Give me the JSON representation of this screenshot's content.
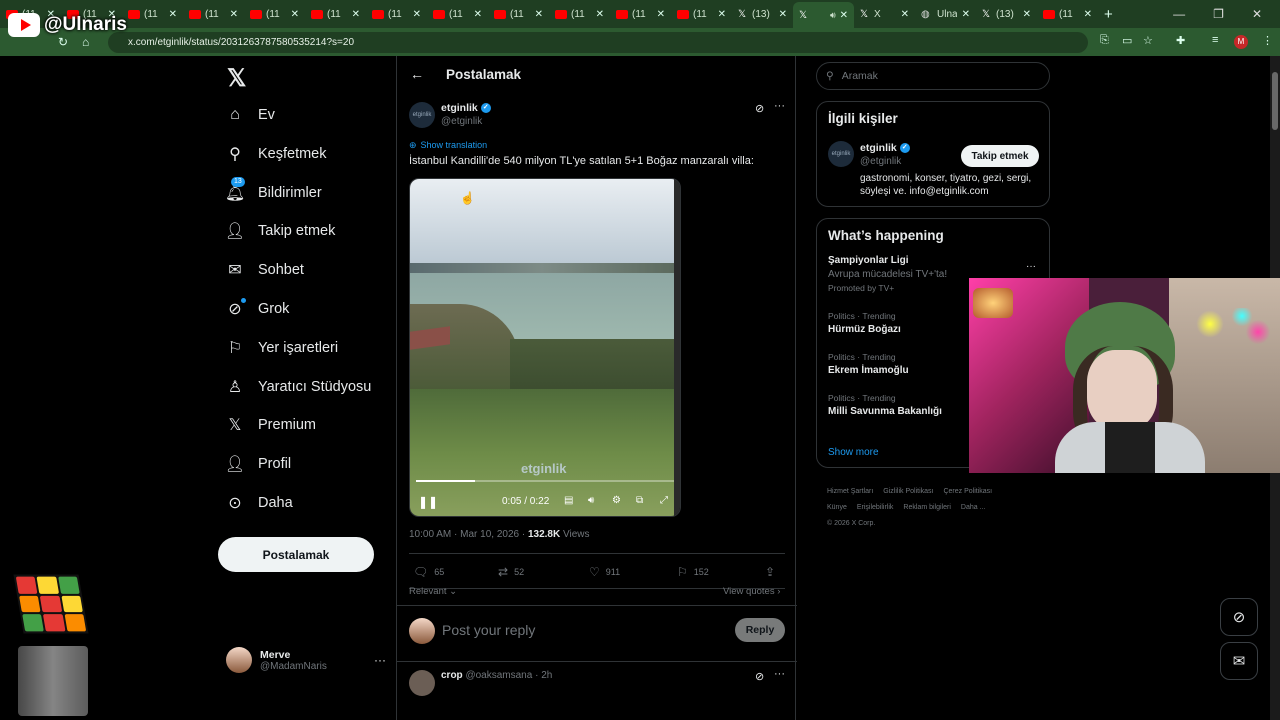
{
  "overlay": {
    "channel_name": "@Ulnaris"
  },
  "browser": {
    "tabs": [
      {
        "icon": "youtube",
        "title": "(11"
      },
      {
        "icon": "youtube",
        "title": "(11"
      },
      {
        "icon": "youtube",
        "title": "(11"
      },
      {
        "icon": "youtube",
        "title": "(11"
      },
      {
        "icon": "youtube",
        "title": "(11"
      },
      {
        "icon": "youtube",
        "title": "(11"
      },
      {
        "icon": "youtube",
        "title": "(11"
      },
      {
        "icon": "youtube",
        "title": "(11"
      },
      {
        "icon": "youtube",
        "title": "(11"
      },
      {
        "icon": "youtube",
        "title": "(11"
      },
      {
        "icon": "youtube",
        "title": "(11"
      },
      {
        "icon": "youtube",
        "title": "(11"
      },
      {
        "icon": "x",
        "title": "(13)"
      },
      {
        "icon": "x",
        "title": "",
        "active": true
      },
      {
        "icon": "x",
        "title": "X"
      },
      {
        "icon": "globe",
        "title": "Ulna"
      },
      {
        "icon": "x",
        "title": "(13)"
      },
      {
        "icon": "youtube",
        "title": "(11"
      }
    ],
    "url": "x.com/etginlik/status/2031263787580535214?s=20",
    "profile_initial": "M"
  },
  "nav": {
    "items": [
      {
        "label": "Ev",
        "icon": "home-icon"
      },
      {
        "label": "Keşfetmek",
        "icon": "search-icon"
      },
      {
        "label": "Bildirimler",
        "icon": "bell-icon",
        "badge": "13"
      },
      {
        "label": "Takip etmek",
        "icon": "follow-icon"
      },
      {
        "label": "Sohbet",
        "icon": "mail-icon"
      },
      {
        "label": "Grok",
        "icon": "grok-icon"
      },
      {
        "label": "Yer işaretleri",
        "icon": "bookmark-icon"
      },
      {
        "label": "Yaratıcı Stüdyosu",
        "icon": "studio-icon"
      },
      {
        "label": "Premium",
        "icon": "x-icon"
      },
      {
        "label": "Profil",
        "icon": "profile-icon"
      },
      {
        "label": "Daha",
        "icon": "more-icon"
      }
    ],
    "post_button": "Postalamak",
    "account": {
      "name": "Merve",
      "handle": "@MadamNaris"
    }
  },
  "timeline": {
    "title": "Postalamak",
    "author": {
      "name": "etginlik",
      "handle": "@etginlik",
      "avatar_text": "etginlik"
    },
    "show_translation": "Show translation",
    "text": "İstanbul Kandilli'de 540 milyon TL'ye satılan 5+1 Boğaz manzaralı villa:",
    "video": {
      "watermark": "etginlik",
      "time": "0:05 / 0:22",
      "progress": 0.23
    },
    "meta": {
      "time": "10:00 AM · Mar 10, 2026 · ",
      "views": "132.8K",
      "views_label": " Views"
    },
    "actions": {
      "replies": "65",
      "reposts": "52",
      "likes": "911",
      "bookmarks": "152"
    },
    "relevant": "Relevant",
    "view_quotes": "View quotes",
    "reply_placeholder": "Post your reply",
    "reply_button": "Reply",
    "first_reply": {
      "name": "crop",
      "handle": "@oaksamsana · 2h"
    }
  },
  "sidebar": {
    "search_placeholder": "Aramak",
    "related": {
      "title": "İlgili kişiler",
      "name": "etginlik",
      "handle": "@etginlik",
      "follow": "Takip etmek",
      "bio": "gastronomi, konser, tiyatro, gezi, sergi, söyleşi ve. info@etginlik.com"
    },
    "happening": {
      "title": "What’s happening",
      "trends": [
        {
          "context": "",
          "name": "Şampiyonlar Ligi",
          "sub": "Avrupa mücadelesi TV+'ta!",
          "promo": "Promoted by TV+"
        },
        {
          "context": "Politics · Trending",
          "name": "Hürmüz Boğazı",
          "sub": "",
          "promo": ""
        },
        {
          "context": "Politics · Trending",
          "name": "Ekrem İmamoğlu",
          "sub": "",
          "promo": ""
        },
        {
          "context": "Politics · Trending",
          "name": "Milli Savunma Bakanlığı",
          "sub": "",
          "promo": ""
        }
      ],
      "show_more": "Show more"
    },
    "footer": [
      "Hizmet Şartları",
      "Gizlilik Politikası",
      "Çerez Politikası",
      "Künye",
      "Erişilebilirlik",
      "Reklam bilgileri",
      "Daha ...",
      "© 2026 X Corp."
    ]
  }
}
